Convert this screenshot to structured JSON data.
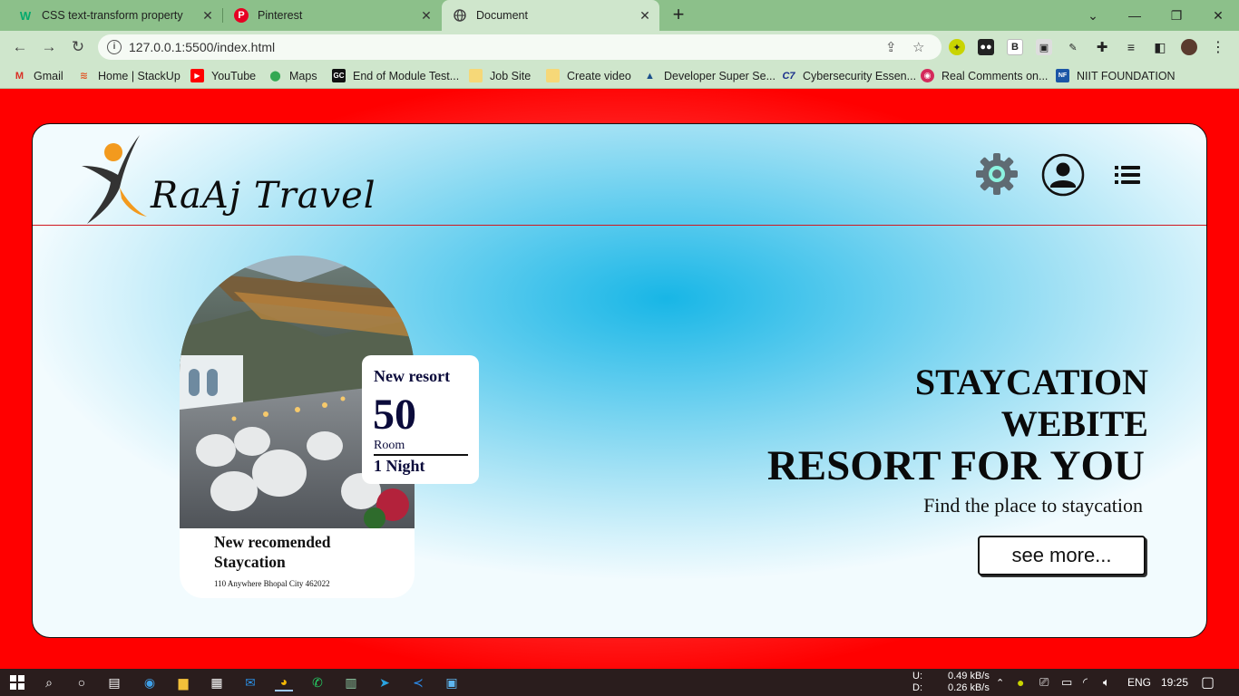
{
  "browser": {
    "tabs": [
      {
        "title": "CSS text-transform property",
        "icon": "w3schools-icon"
      },
      {
        "title": "Pinterest",
        "icon": "pinterest-icon"
      },
      {
        "title": "Document",
        "icon": "globe-icon",
        "active": true
      }
    ],
    "url": "127.0.0.1:5500/index.html",
    "bookmarks": [
      {
        "label": "Gmail",
        "icon": "gmail-icon"
      },
      {
        "label": "Home | StackUp",
        "icon": "stackup-icon"
      },
      {
        "label": "YouTube",
        "icon": "youtube-icon"
      },
      {
        "label": "Maps",
        "icon": "maps-icon"
      },
      {
        "label": "End of Module Test...",
        "icon": "gc-icon"
      },
      {
        "label": "Job Site",
        "icon": "folder-icon"
      },
      {
        "label": "Create video",
        "icon": "folder-icon"
      },
      {
        "label": "Developer Super Se...",
        "icon": "developer-icon"
      },
      {
        "label": "Cybersecurity Essen...",
        "icon": "c7-icon"
      },
      {
        "label": "Real Comments on...",
        "icon": "comments-icon"
      },
      {
        "label": "NIIT FOUNDATION",
        "icon": "niit-icon"
      }
    ]
  },
  "site": {
    "brand": "RaAj Travel",
    "card": {
      "badge_title": "New resort",
      "badge_number": "50",
      "badge_unit": "Room",
      "badge_duration": "1 Night",
      "title": "New recomended Staycation",
      "address": "110 Anywhere Bhopal City 462022"
    },
    "hero": {
      "line1": "STAYCATION",
      "line2": "WEBITE",
      "line3": "RESORT FOR YOU",
      "subtitle": "Find the place to staycation",
      "button": "see more..."
    }
  },
  "taskbar": {
    "net_up_label": "U:",
    "net_down_label": "D:",
    "net_up": "0.49 kB/s",
    "net_down": "0.26 kB/s",
    "lang": "ENG",
    "time": "19:25"
  },
  "colors": {
    "page_red": "#ff0000",
    "accent_blue": "#18b6e6",
    "logo_orange": "#f39a1e",
    "logo_dark": "#333333"
  }
}
